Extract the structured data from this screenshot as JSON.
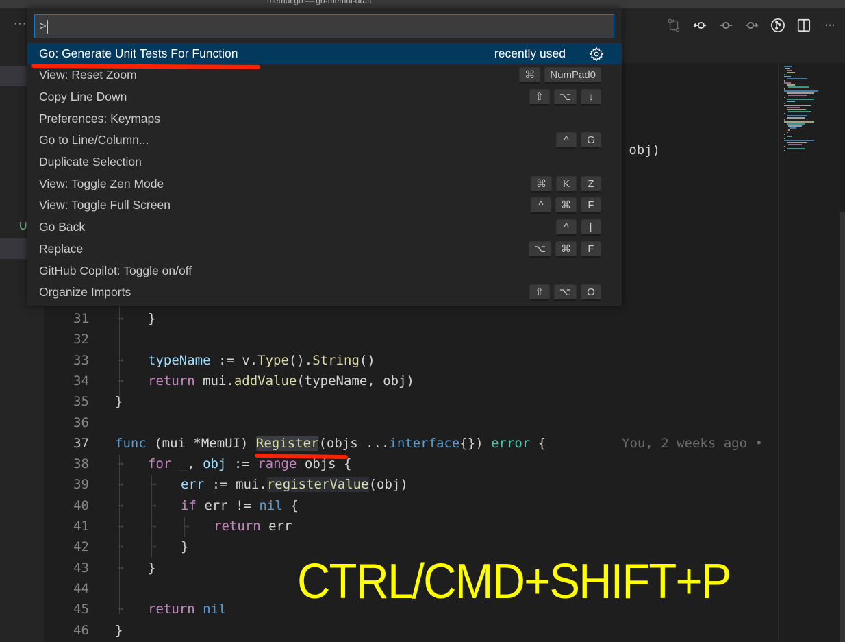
{
  "window": {
    "title": "memui.go — go-memui-draft"
  },
  "toolbar": {
    "more_label": "···",
    "actions": [
      {
        "icon": "compare-changes-icon"
      },
      {
        "icon": "previous-change-icon"
      },
      {
        "icon": "commit-icon"
      },
      {
        "icon": "next-change-icon"
      },
      {
        "icon": "git-graph-icon"
      },
      {
        "icon": "split-editor-icon"
      },
      {
        "icon": "more-actions-icon",
        "label": "···"
      }
    ]
  },
  "sidebar": {
    "status_letter": "U"
  },
  "palette": {
    "input_value": ">",
    "items": [
      {
        "label": "Go: Generate Unit Tests For Function",
        "detail": "recently used",
        "keys": [],
        "selected": true
      },
      {
        "label": "View: Reset Zoom",
        "keys": [
          "⌘",
          "NumPad0"
        ]
      },
      {
        "label": "Copy Line Down",
        "keys": [
          "⇧",
          "⌥",
          "↓"
        ]
      },
      {
        "label": "Preferences: Keymaps",
        "keys": []
      },
      {
        "label": "Go to Line/Column...",
        "keys": [
          "^",
          "G"
        ]
      },
      {
        "label": "Duplicate Selection",
        "keys": []
      },
      {
        "label": "View: Toggle Zen Mode",
        "keys": [
          "⌘",
          "K",
          "Z"
        ]
      },
      {
        "label": "View: Toggle Full Screen",
        "keys": [
          "^",
          "⌘",
          "F"
        ]
      },
      {
        "label": "Go Back",
        "keys": [
          "^",
          "["
        ]
      },
      {
        "label": "Replace",
        "keys": [
          "⌥",
          "⌘",
          "F"
        ]
      },
      {
        "label": "GitHub Copilot: Toggle on/off",
        "keys": []
      },
      {
        "label": "Organize Imports",
        "keys": [
          "⇧",
          "⌥",
          "O"
        ]
      }
    ]
  },
  "editor": {
    "peek_fragment": "], obj)",
    "lines": [
      {
        "n": "31",
        "html": "}"
      },
      {
        "n": "32",
        "html": ""
      },
      {
        "n": "33",
        "html": "typeName := v.Type().String()"
      },
      {
        "n": "34",
        "html": "return mui.addValue(typeName, obj)"
      },
      {
        "n": "35",
        "html": "}"
      },
      {
        "n": "36",
        "html": ""
      },
      {
        "n": "37",
        "html": "func (mui *MemUI) Register(objs ...interface{}) error {"
      },
      {
        "n": "38",
        "html": "for _, obj := range objs {"
      },
      {
        "n": "39",
        "html": "err := mui.registerValue(obj)"
      },
      {
        "n": "40",
        "html": "if err != nil {"
      },
      {
        "n": "41",
        "html": "return err"
      },
      {
        "n": "42",
        "html": "}"
      },
      {
        "n": "43",
        "html": "}"
      },
      {
        "n": "44",
        "html": ""
      },
      {
        "n": "45",
        "html": "return nil"
      },
      {
        "n": "46",
        "html": "}"
      }
    ],
    "blame": "You, 2 weeks ago •"
  },
  "annotation": {
    "text": "CTRL/CMD+SHIFT+P",
    "color": "#ffff00"
  },
  "colors": {
    "accent": "#0e7fd0",
    "selection": "#04395e",
    "underline": "#ff2200"
  }
}
